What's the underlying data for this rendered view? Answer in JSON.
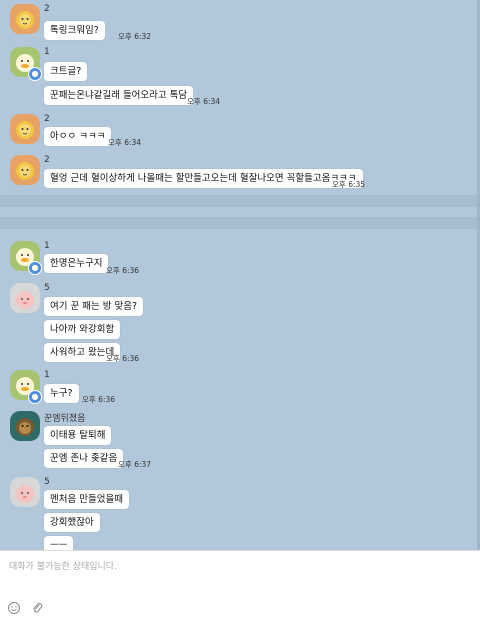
{
  "ampm": "오후",
  "messages": [
    {
      "sender": "2",
      "avatar": "lion",
      "texts": [
        "톡링크뭐임?"
      ],
      "time": "6:32"
    },
    {
      "sender": "1",
      "avatar": "duck",
      "badge": "●",
      "texts": [
        "크트글?",
        "꾼패는온냐같길래 들어오라고 톡담"
      ],
      "time": "6:34"
    },
    {
      "sender": "2",
      "avatar": "lion",
      "texts": [
        "아ㅇㅇ ㅋㅋㅋ"
      ],
      "time": "6:34"
    },
    {
      "sender": "2",
      "avatar": "lion",
      "texts": [
        "혈엉 근데 혈이상하게 나올때는 할만들고오는데 혈잘나오면 꼭할들고옴ㅋㅋㅋ"
      ],
      "time": "6:35"
    },
    {
      "sender": "1",
      "avatar": "duck",
      "badge": "●",
      "texts": [
        "한명은누구지"
      ],
      "time": "6:36"
    },
    {
      "sender": "5",
      "avatar": "peach",
      "texts": [
        "여기 꾼 패는 방 맞음?",
        "나아까 와강회함",
        "사워하고 왔는데"
      ],
      "time": "6:36"
    },
    {
      "sender": "1",
      "avatar": "duck",
      "badge": "●",
      "texts": [
        "누구?"
      ],
      "time": "6:36"
    },
    {
      "sender": "꾼엠뒤졌음",
      "avatar": "dark",
      "texts": [
        "이태용 탈퇴해",
        "꾼엠 존나 좆같음"
      ],
      "time": "6:37"
    },
    {
      "sender": "5",
      "avatar": "peach",
      "texts": [
        "멘처음 만들었을때",
        "강회했잖아",
        "ㅡㅡ"
      ],
      "time": ""
    }
  ],
  "input": {
    "placeholder": "대화가 불가능한 상태입니다."
  },
  "icons": {
    "emoji": "smiley-icon",
    "attach": "paperclip-icon"
  }
}
